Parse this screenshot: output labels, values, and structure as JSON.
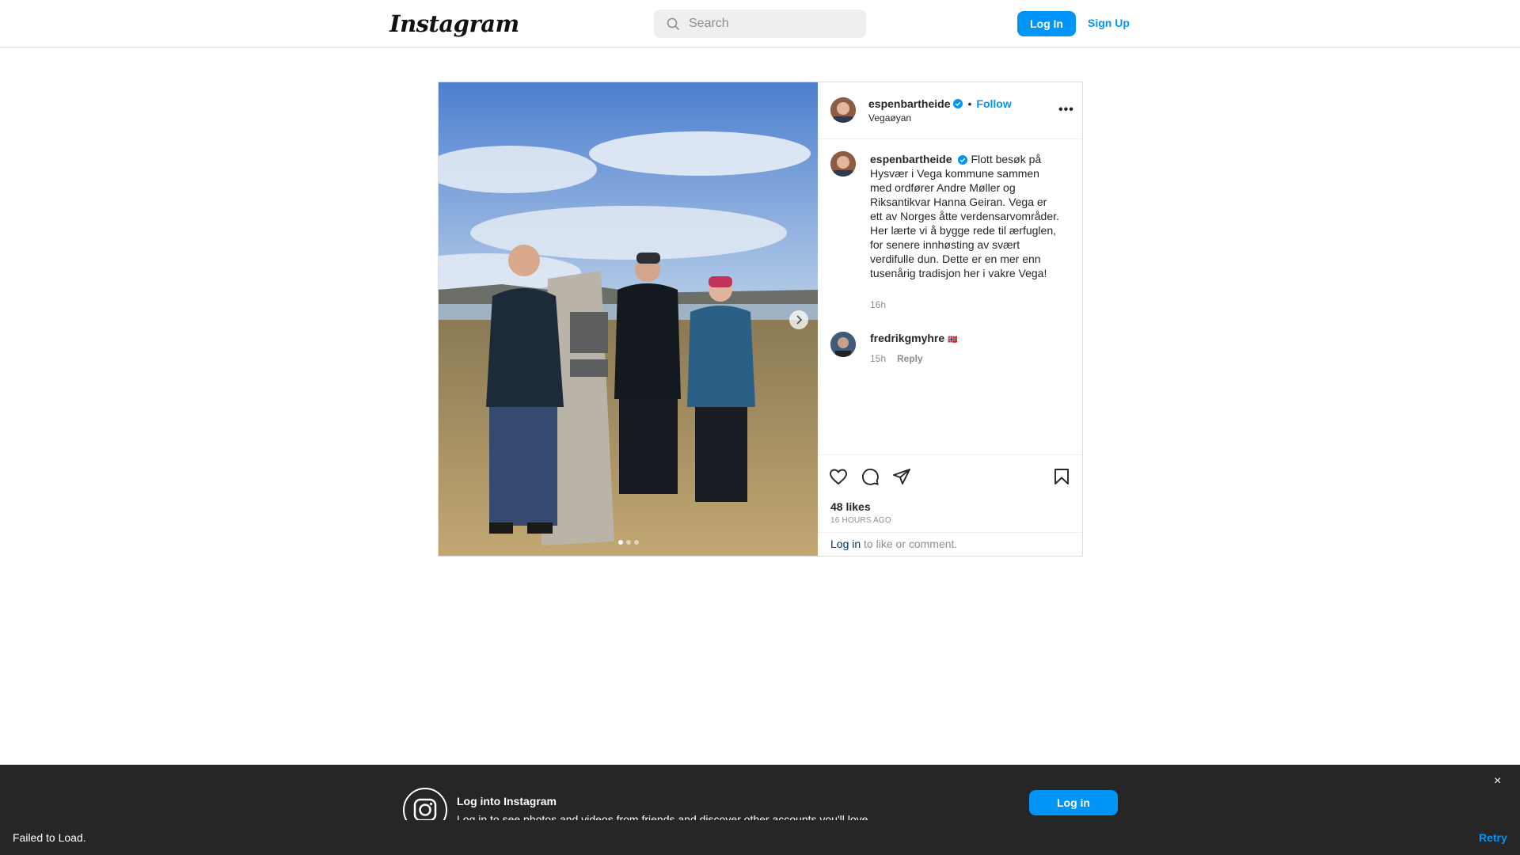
{
  "header": {
    "logo_text": "Instagram",
    "search_placeholder": "Search",
    "login_label": "Log In",
    "signup_label": "Sign Up"
  },
  "post": {
    "username": "espenbartheide",
    "verified": true,
    "follow_label": "Follow",
    "location": "Vegaøyan",
    "more_icon": "ellipsis-icon",
    "caption": "Flott besøk på Hysvær i Vega kommune sammen med ordfører Andre Møller og Riksantikvar Hanna Geiran. Vega er ett av Norges åtte verdensarvområder. Her lærte vi å bygge rede til ærfuglen, for senere innhøsting av svært verdifulle dun. Dette er en mer enn tusenårig tradisjon her i vakre Vega!",
    "caption_time": "16h",
    "comments": [
      {
        "username": "fredrikgmyhre",
        "text": "🇳🇴",
        "time": "15h",
        "reply_label": "Reply"
      }
    ],
    "likes": "48 likes",
    "posted_ago": "16 HOURS AGO",
    "login_prompt_link": "Log in",
    "login_prompt_rest": " to like or comment.",
    "carousel": {
      "current": 1,
      "total": 3
    }
  },
  "banner": {
    "title": "Log into Instagram",
    "subtitle": "Log in to see photos and videos from friends and discover other accounts you'll love.",
    "login_label": "Log in",
    "close_glyph": "×"
  },
  "error_bar": {
    "message": "Failed to Load.",
    "retry_label": "Retry"
  },
  "colors": {
    "accent": "#0095f6",
    "link_dark": "#00376b",
    "muted": "#8e8e8e",
    "banner_bg": "#262626"
  }
}
